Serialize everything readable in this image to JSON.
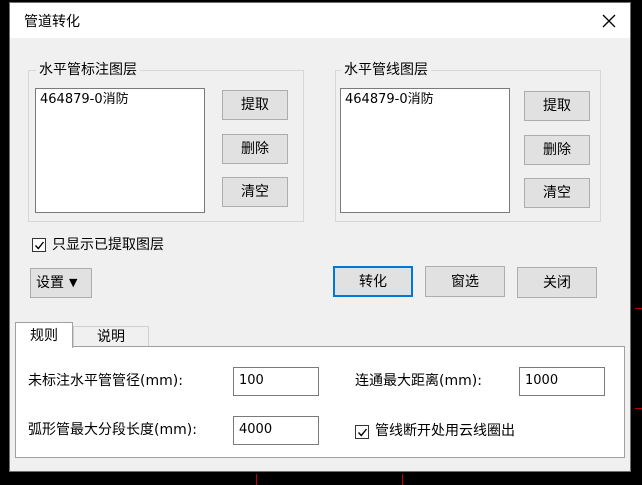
{
  "window": {
    "title": "管道转化",
    "close_symbol": "✕"
  },
  "horizontal_annotation_layer": {
    "legend": "水平管标注图层",
    "items": [
      "464879-0消防"
    ],
    "buttons": {
      "extract": "提取",
      "delete": "删除",
      "clear": "清空"
    }
  },
  "horizontal_pipe_layer": {
    "legend": "水平管线图层",
    "items": [
      "464879-0消防"
    ],
    "buttons": {
      "extract": "提取",
      "delete": "删除",
      "clear": "清空"
    }
  },
  "show_extracted_only": {
    "label": "只显示已提取图层",
    "checked": true
  },
  "settings": {
    "label": "设置",
    "arrow": "▼"
  },
  "actions": {
    "convert": "转化",
    "window_select": "窗选",
    "close": "关闭"
  },
  "tabs": [
    {
      "label": "规则",
      "active": true
    },
    {
      "label": "说明",
      "active": false
    }
  ],
  "rules": {
    "unlabeled_diameter_label": "未标注水平管管径(mm):",
    "unlabeled_diameter_value": "100",
    "max_connect_distance_label": "连通最大距离(mm):",
    "max_connect_distance_value": "1000",
    "arc_segment_length_label": "弧形管最大分段长度(mm):",
    "arc_segment_length_value": "4000",
    "cloud_mark_label": "管线断开处用云线圈出",
    "cloud_mark_checked": true
  },
  "colors": {
    "dialog_bg": "#f0f0f0",
    "accent": "#0078d7",
    "background": "#000000",
    "cad_red": "#c00000"
  }
}
